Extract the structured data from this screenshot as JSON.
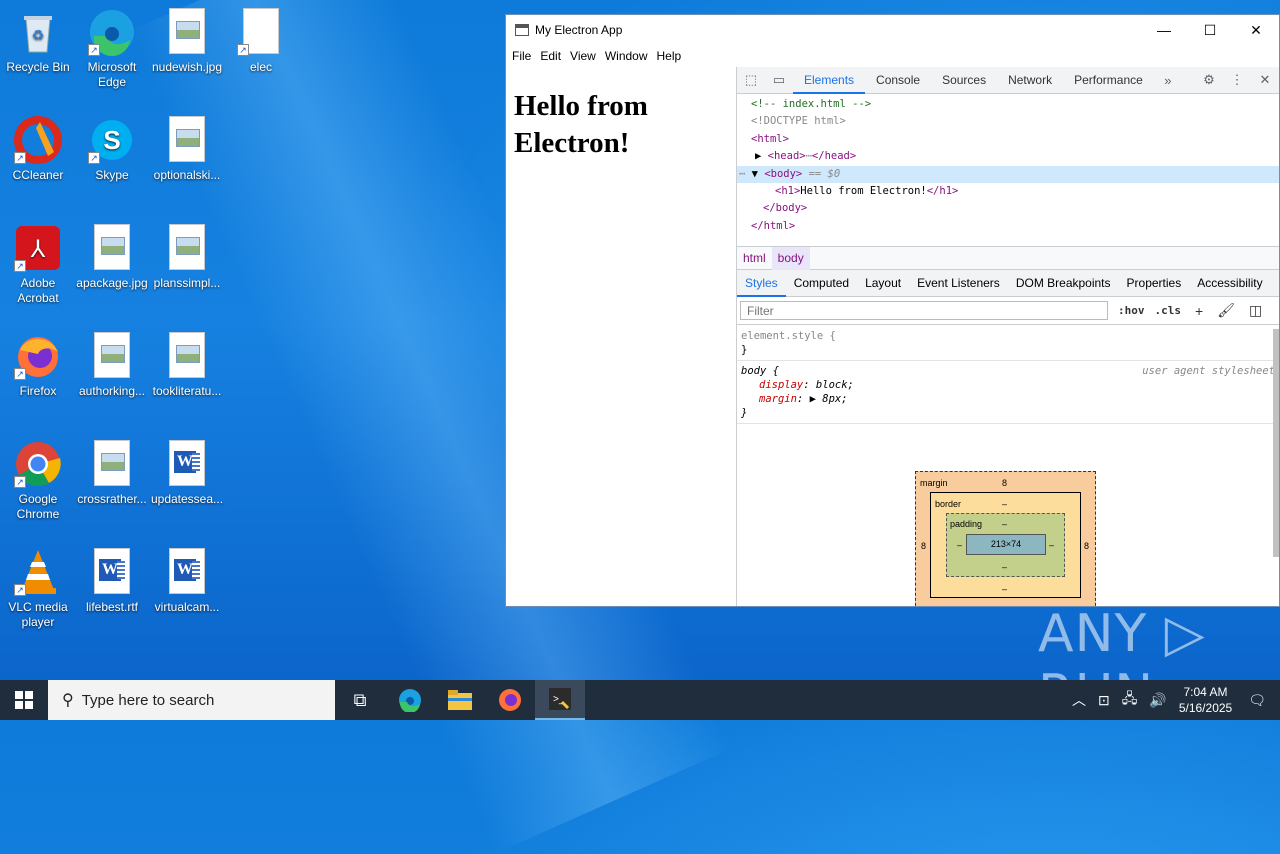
{
  "desktop": {
    "icons": [
      {
        "label": "Recycle Bin",
        "icon": "recycle-bin-icon"
      },
      {
        "label": "Microsoft Edge",
        "icon": "edge-icon"
      },
      {
        "label": "nudewish.jpg",
        "icon": "image-file-icon"
      },
      {
        "label": "elec",
        "icon": "blank-file-icon"
      },
      {
        "label": "CCleaner",
        "icon": "ccleaner-icon"
      },
      {
        "label": "Skype",
        "icon": "skype-icon"
      },
      {
        "label": "optionalski...",
        "icon": "image-file-icon"
      },
      {
        "label": "Adobe Acrobat",
        "icon": "acrobat-icon"
      },
      {
        "label": "apackage.jpg",
        "icon": "image-file-icon"
      },
      {
        "label": "planssimpl...",
        "icon": "image-file-icon"
      },
      {
        "label": "Firefox",
        "icon": "firefox-icon"
      },
      {
        "label": "authorking...",
        "icon": "image-file-icon"
      },
      {
        "label": "tookliteratu...",
        "icon": "image-file-icon"
      },
      {
        "label": "Google Chrome",
        "icon": "chrome-icon"
      },
      {
        "label": "crossrather...",
        "icon": "image-file-icon"
      },
      {
        "label": "updatessea...",
        "icon": "word-doc-icon"
      },
      {
        "label": "VLC media player",
        "icon": "vlc-icon"
      },
      {
        "label": "lifebest.rtf",
        "icon": "word-doc-icon"
      },
      {
        "label": "virtualcam...",
        "icon": "word-doc-icon"
      }
    ]
  },
  "window": {
    "title": "My Electron App",
    "menu": [
      "File",
      "Edit",
      "View",
      "Window",
      "Help"
    ],
    "heading": "Hello from Electron!"
  },
  "devtools": {
    "tabs": [
      "Elements",
      "Console",
      "Sources",
      "Network",
      "Performance"
    ],
    "more": "»",
    "dom": {
      "comment": "<!-- index.html -->",
      "doctype": "<!DOCTYPE html>",
      "html_open": "<html>",
      "head": "<head>",
      "head_ellipsis": "⋯",
      "head_close": "</head>",
      "body_open": "<body>",
      "body_eq": "== $0",
      "h1_open": "<h1>",
      "h1_text": "Hello from Electron!",
      "h1_close": "</h1>",
      "body_close": "</body>",
      "html_close": "</html>"
    },
    "breadcrumbs": [
      "html",
      "body"
    ],
    "style_tabs": [
      "Styles",
      "Computed",
      "Layout",
      "Event Listeners",
      "DOM Breakpoints",
      "Properties",
      "Accessibility"
    ],
    "filter_placeholder": "Filter",
    "hov": ":hov",
    "cls": ".cls",
    "element_style": "element.style {",
    "close_brace": "}",
    "body_rule": "body {",
    "ua": "user agent stylesheet",
    "props": [
      {
        "name": "display",
        "value": "block;"
      },
      {
        "name": "margin",
        "value": "8px;"
      }
    ],
    "boxmodel": {
      "margin_label": "margin",
      "margin": "8",
      "border_label": "border",
      "border": "–",
      "padding_label": "padding",
      "padding": "–",
      "content": "213×74"
    }
  },
  "taskbar": {
    "search_placeholder": "Type here to search",
    "time": "7:04 AM",
    "date": "5/16/2025"
  },
  "watermark": "ANY ▷ RUN"
}
